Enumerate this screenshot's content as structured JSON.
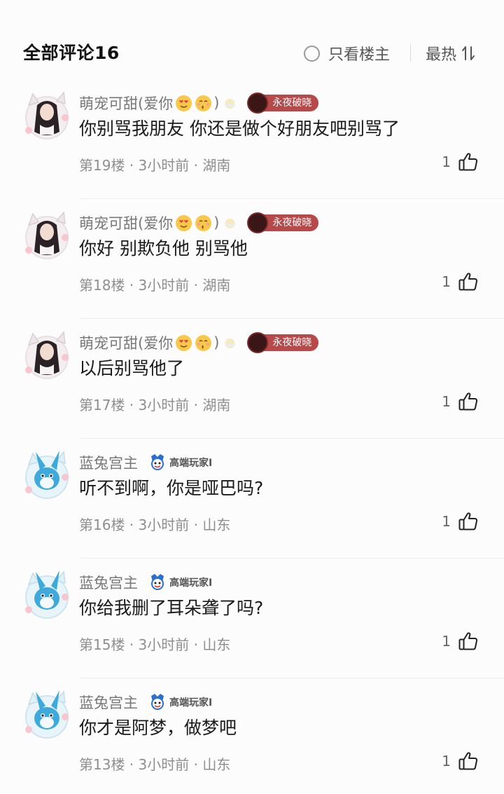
{
  "header": {
    "title": "全部评论16",
    "only_op_label": "只看楼主",
    "sort_label": "最热",
    "sort_icon": "sort-arrows-icon"
  },
  "colors": {
    "badge_bg": "#b64a4a",
    "text_secondary": "#8e8e8e",
    "divider": "#ececec"
  },
  "comments": [
    {
      "username": "萌宠可甜(爱你",
      "suffix": ")",
      "emojis": [
        "heart-eyes-emoji",
        "kiss-emoji",
        "sun-emoji"
      ],
      "badge": "永夜破晓",
      "text": "你别骂我朋友 你还是做个好朋友吧别骂了",
      "meta": "第19楼 · 3小时前 · 湖南",
      "likes": "1"
    },
    {
      "username": "萌宠可甜(爱你",
      "suffix": ")",
      "emojis": [
        "heart-eyes-emoji",
        "kiss-emoji",
        "sun-emoji"
      ],
      "badge": "永夜破晓",
      "text": "你好 别欺负他 别骂他",
      "meta": "第18楼 · 3小时前 · 湖南",
      "likes": "1"
    },
    {
      "username": "萌宠可甜(爱你",
      "suffix": ")",
      "emojis": [
        "heart-eyes-emoji",
        "kiss-emoji",
        "sun-emoji"
      ],
      "badge": "永夜破晓",
      "text": "以后别骂他了",
      "meta": "第17楼 · 3小时前 · 湖南",
      "likes": "1"
    },
    {
      "username": "蓝兔宫主",
      "badge": "高端玩家I",
      "text": "听不到啊，你是哑巴吗?",
      "meta": "第16楼 · 3小时前 · 山东",
      "likes": "1"
    },
    {
      "username": "蓝兔宫主",
      "badge": "高端玩家I",
      "text": "你给我删了耳朵聋了吗?",
      "meta": "第15楼 · 3小时前 · 山东",
      "likes": "1"
    },
    {
      "username": "蓝兔宫主",
      "badge": "高端玩家I",
      "text": "你才是阿梦，做梦吧",
      "meta": "第13楼 · 3小时前 · 山东",
      "likes": "1"
    }
  ]
}
